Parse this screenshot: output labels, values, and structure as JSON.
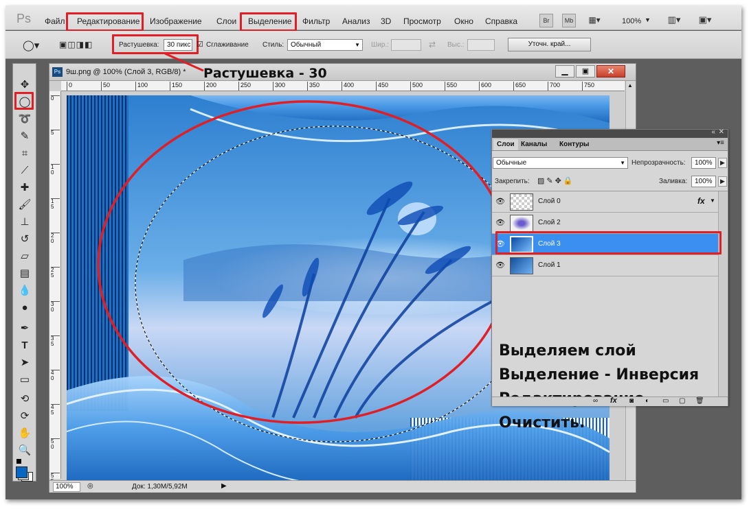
{
  "app": {
    "logo": "Ps"
  },
  "menubar": {
    "items": [
      "Файл",
      "Редактирование",
      "Изображение",
      "Слои",
      "Выделение",
      "Фильтр",
      "Анализ",
      "3D",
      "Просмотр",
      "Окно",
      "Справка"
    ],
    "br_label": "Br",
    "mb_label": "Mb",
    "zoom": "100%"
  },
  "options": {
    "feather_label": "Растушевка:",
    "feather_value": "30 пикс",
    "antialias_label": "Сглаживание",
    "style_label": "Стиль:",
    "style_value": "Обычный",
    "width_label": "Шир.:",
    "height_label": "Выс.:",
    "refine_button": "Уточн. край..."
  },
  "annotation": {
    "feather_note": "Растушевка - 30"
  },
  "document": {
    "title": "9ш.png @ 100% (Слой 3, RGB/8) *",
    "ruler_ticks": [
      "0",
      "50",
      "100",
      "150",
      "200",
      "250",
      "300",
      "350",
      "400",
      "450",
      "500",
      "550",
      "600",
      "650",
      "700",
      "750"
    ],
    "ruler_v_ticks": [
      "0",
      "5",
      "1\n0",
      "1\n5",
      "2\n0",
      "2\n5",
      "3\n0",
      "3\n5",
      "4\n0",
      "4\n5",
      "5\n0",
      "5\n5"
    ],
    "status_zoom": "100%",
    "status_doc": "Док: 1,30M/5,92M"
  },
  "layers_panel": {
    "tabs": [
      "Слои",
      "Каналы",
      "Контуры"
    ],
    "blend_mode": "Обычные",
    "opacity_label": "Непрозрачность:",
    "opacity_value": "100%",
    "lock_label": "Закрепить:",
    "fill_label": "Заливка:",
    "fill_value": "100%",
    "layers": [
      {
        "name": "Слой 0",
        "fx": "fx",
        "selected": false
      },
      {
        "name": "Слой 2",
        "selected": false
      },
      {
        "name": "Слой 3",
        "selected": true
      },
      {
        "name": "Слой 1",
        "selected": false
      }
    ],
    "fx_button": "fx",
    "instructions": [
      "Выделяем слой",
      "Выделение - Инверсия",
      "Редактирование -",
      "Очистить."
    ]
  },
  "colors": {
    "accent_red": "#e01e25",
    "selection_blue": "#3b8ff0",
    "foreground_color": "#0a67c1",
    "background_color": "#ffffff"
  }
}
